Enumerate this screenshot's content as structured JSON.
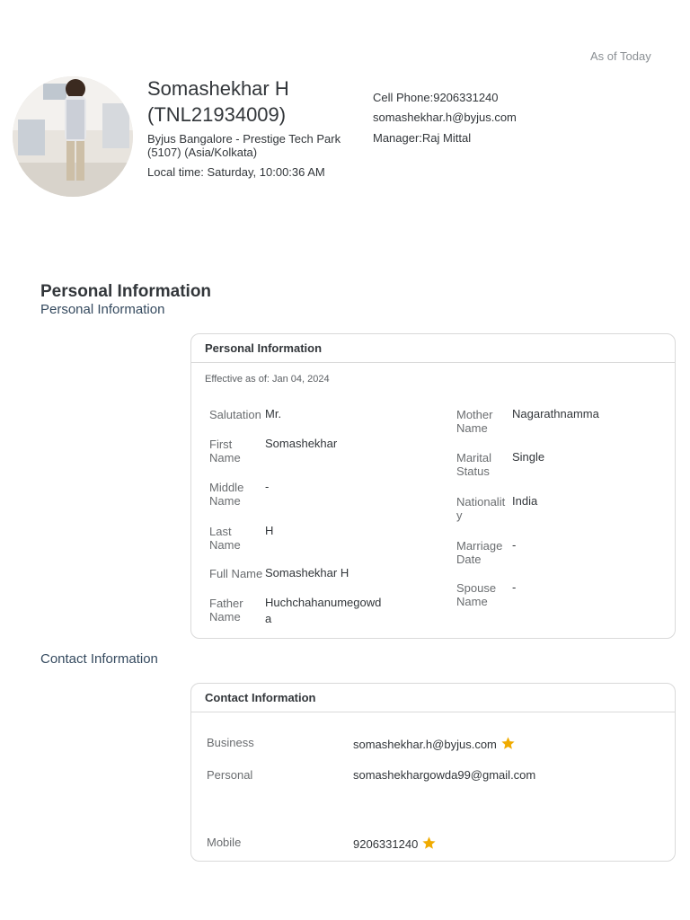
{
  "header": {
    "as_of": "As of Today",
    "name": "Somashekhar H (TNL21934009)",
    "location": "Byjus Bangalore - Prestige Tech Park (5107) (Asia/Kolkata)",
    "local_time": "Local time: Saturday, 10:00:36 AM",
    "cell_phone": "Cell Phone:9206331240",
    "email": "somashekhar.h@byjus.com",
    "manager": "Manager:Raj Mittal"
  },
  "personal_section": {
    "heading": "Personal Information",
    "subheading": "Personal Information",
    "card_title": "Personal Information",
    "effective": "Effective as of: Jan 04, 2024",
    "left_fields": [
      {
        "label": "Salutation",
        "value": "Mr."
      },
      {
        "label": "First Name",
        "value": "Somashekhar"
      },
      {
        "label": "Middle Name",
        "value": "-"
      },
      {
        "label": "Last Name",
        "value": "H"
      },
      {
        "label": "Full Name",
        "value": "Somashekhar H"
      },
      {
        "label": "Father Name",
        "value": "Huchchahanumegowda"
      }
    ],
    "right_fields": [
      {
        "label": "Mother Name",
        "value": "Nagarathnamma"
      },
      {
        "label": "Marital Status",
        "value": "Single"
      },
      {
        "label": "Nationality",
        "value": "India"
      },
      {
        "label": "Marriage Date",
        "value": "-"
      },
      {
        "label": "Spouse Name",
        "value": "-"
      }
    ]
  },
  "contact_section": {
    "subheading": "Contact Information",
    "card_title": "Contact Information",
    "rows": [
      {
        "label": "Business",
        "value": "somashekhar.h@byjus.com",
        "primary": true
      },
      {
        "label": "Personal",
        "value": "somashekhargowda99@gmail.com",
        "primary": false
      },
      {
        "label": "Mobile",
        "value": "9206331240",
        "primary": true
      }
    ]
  },
  "icons": {
    "primary_marker": "star-icon",
    "star_color": "#f0ab00"
  }
}
